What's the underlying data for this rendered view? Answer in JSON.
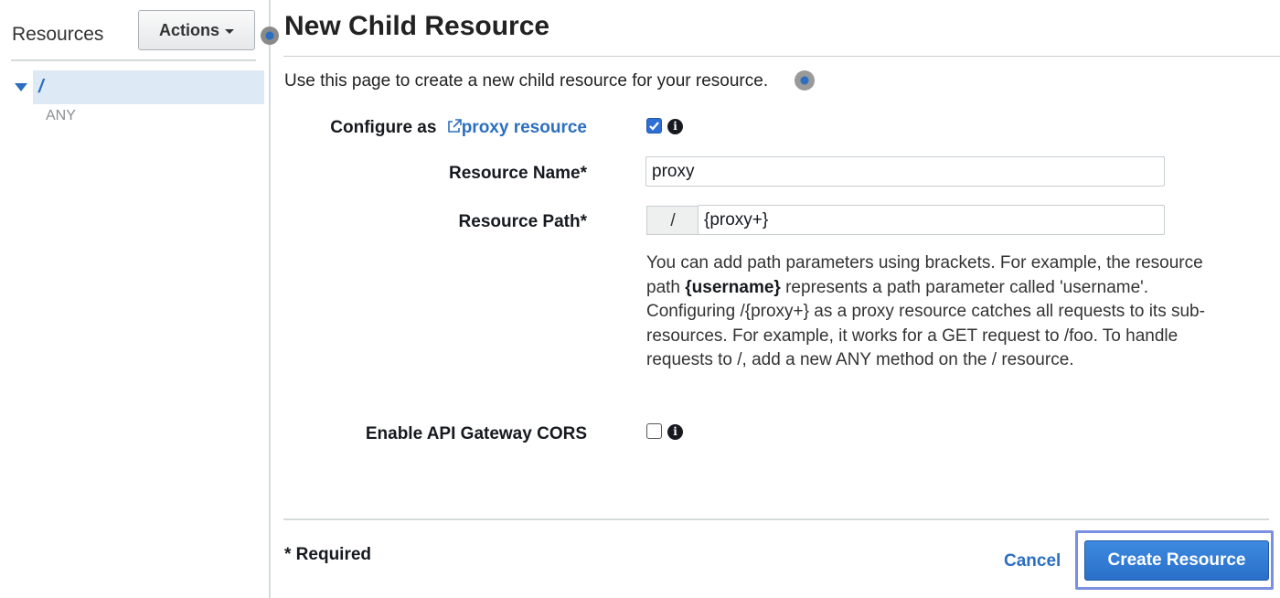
{
  "sidebar": {
    "title": "Resources",
    "actions_label": "Actions",
    "tree": {
      "root_label": "/",
      "method": "ANY"
    }
  },
  "main": {
    "title": "New Child Resource",
    "intro": "Use this page to create a new child resource for your resource.",
    "configure": {
      "label": "Configure as",
      "link": "proxy resource",
      "checked": true
    },
    "resource_name": {
      "label": "Resource Name*",
      "value": "proxy"
    },
    "resource_path": {
      "label": "Resource Path*",
      "prefix": "/",
      "value": "{proxy+}"
    },
    "help": {
      "part1": "You can add path parameters using brackets. For example, the resource path ",
      "bold": "{username}",
      "part2": " represents a path parameter called 'username'. Configuring /{proxy+} as a proxy resource catches all requests to its sub-resources. For example, it works for a GET request to /foo. To handle requests to /, add a new ANY method on the / resource."
    },
    "cors": {
      "label": "Enable API Gateway CORS",
      "checked": false
    }
  },
  "footer": {
    "required_note": "* Required",
    "cancel_label": "Cancel",
    "create_label": "Create Resource"
  },
  "colors": {
    "accent": "#2c6fbf",
    "primary_button": "#2a6fc9",
    "focus_ring": "#7a8fe0",
    "selected_row": "#dde9f5"
  },
  "icons": [
    "caret-down-icon",
    "external-link-icon",
    "info-icon",
    "checkbox-checked-icon",
    "tree-expand-icon"
  ]
}
